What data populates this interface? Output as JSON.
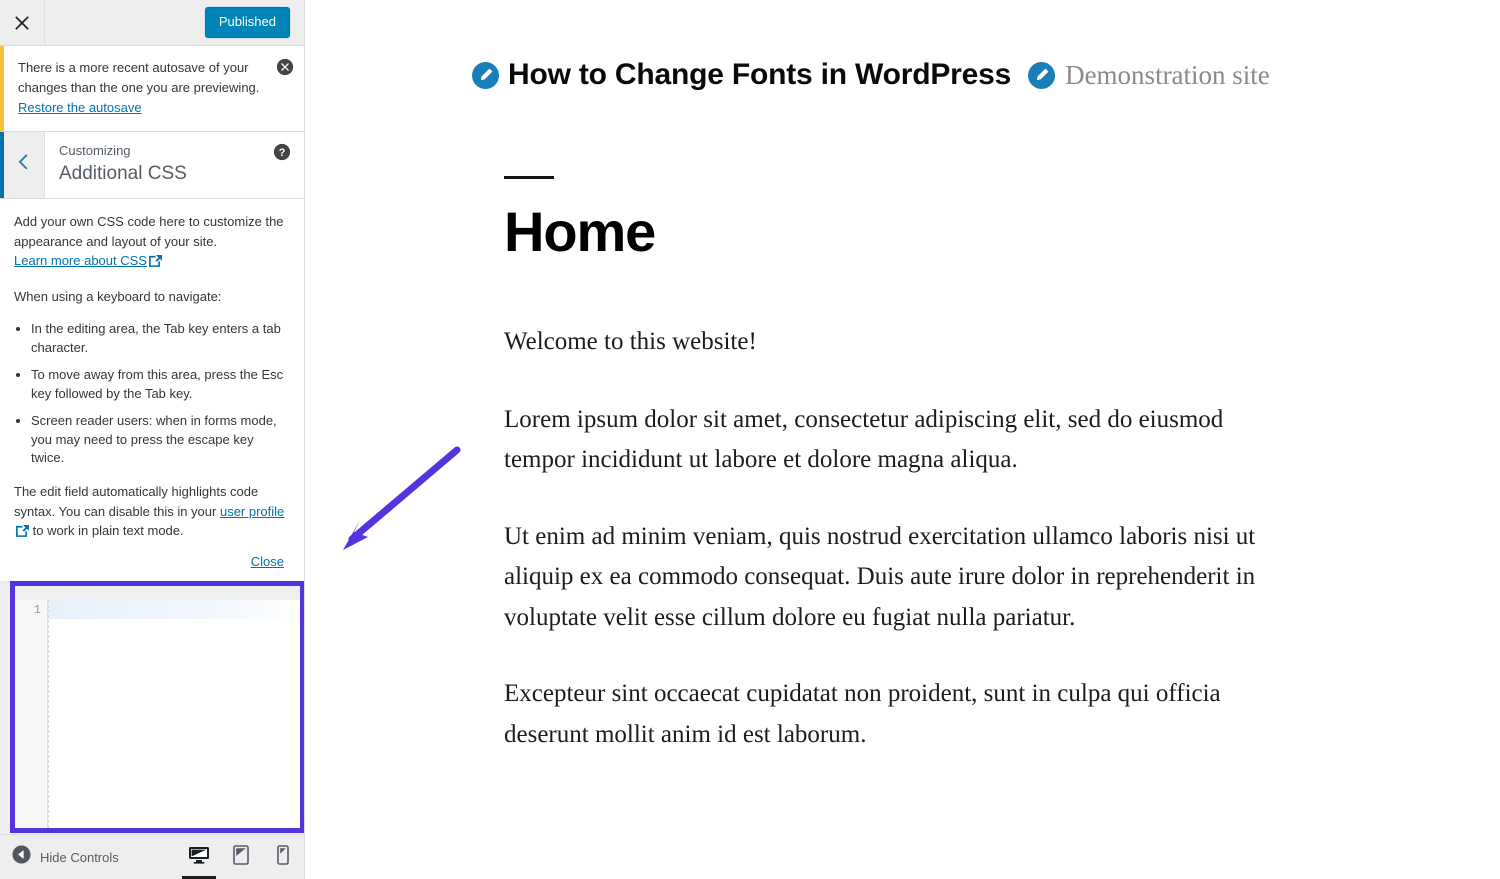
{
  "colors": {
    "accent_blue": "#0085ba",
    "link_blue": "#0073aa",
    "notice_amber": "#f0c33c",
    "annotation_purple": "#5533dd",
    "sidebar_bg": "#eeeeee"
  },
  "sidebar": {
    "header": {
      "close_icon": "close-icon",
      "published_label": "Published"
    },
    "notice": {
      "text_before_link": "There is a more recent autosave of your changes than the one you are previewing. ",
      "link_label": "Restore the autosave",
      "dismiss_icon": "dismiss-circle-icon"
    },
    "panel": {
      "back_icon": "chevron-left-icon",
      "subtitle": "Customizing",
      "title": "Additional CSS",
      "help_icon": "help-circle-icon"
    },
    "description": {
      "intro": "Add your own CSS code here to customize the appearance and layout of your site.",
      "learn_more_link": "Learn more about CSS",
      "keyboard_heading": "When using a keyboard to navigate:",
      "bullets": [
        "In the editing area, the Tab key enters a tab character.",
        "To move away from this area, press the Esc key followed by the Tab key.",
        "Screen reader users: when in forms mode, you may need to press the escape key twice."
      ],
      "syntax_note_before": "The edit field automatically highlights code syntax. You can disable this in your ",
      "user_profile_link": "user profile",
      "syntax_note_after": " to work in plain text mode.",
      "close_label": "Close"
    },
    "editor": {
      "line_number": "1",
      "code_value": "",
      "highlighted": true
    },
    "footer": {
      "collapse_icon": "collapse-left-icon",
      "hide_controls_label": "Hide Controls",
      "devices": [
        {
          "name": "desktop-preview",
          "icon": "desktop-icon",
          "active": true
        },
        {
          "name": "tablet-preview",
          "icon": "tablet-icon",
          "active": false
        },
        {
          "name": "mobile-preview",
          "icon": "mobile-icon",
          "active": false
        }
      ]
    }
  },
  "preview": {
    "site_title": "How to Change Fonts in WordPress",
    "site_tagline": "Demonstration site",
    "edit_icon": "pencil-edit-icon",
    "page_title": "Home",
    "paragraphs": [
      "Welcome to this website!",
      "Lorem ipsum dolor sit amet, consectetur adipiscing elit, sed do eiusmod tempor incididunt ut labore et dolore magna aliqua.",
      "Ut enim ad minim veniam, quis nostrud exercitation ullamco laboris nisi ut aliquip ex ea commodo consequat. Duis aute irure dolor in reprehenderit in voluptate velit esse cillum dolore eu fugiat nulla pariatur.",
      "Excepteur sint occaecat cupidatat non proident, sunt in culpa qui officia deserunt mollit anim id est laborum."
    ]
  },
  "annotation": {
    "arrow_name": "purple-annotation-arrow",
    "points_to": "css-editor-field"
  }
}
